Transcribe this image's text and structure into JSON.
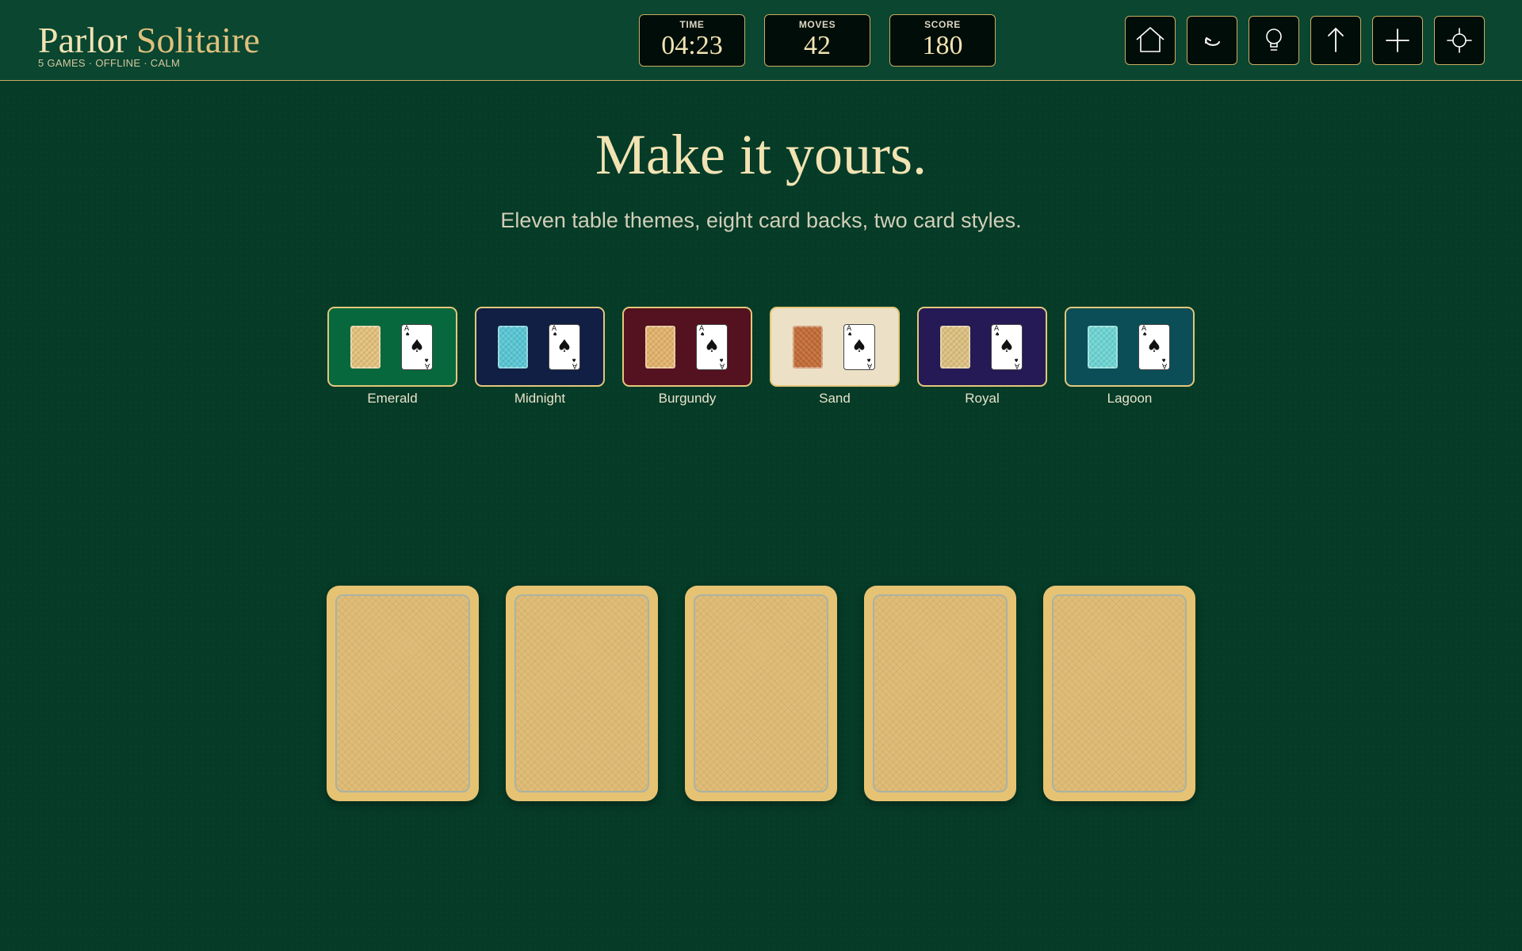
{
  "app": {
    "title_part1": "Parlor",
    "title_part2": "Solitaire",
    "subtitle": "5 GAMES · OFFLINE · CALM"
  },
  "stats": {
    "time": {
      "label": "TIME",
      "value": "04:23"
    },
    "moves": {
      "label": "MOVES",
      "value": "42"
    },
    "score": {
      "label": "SCORE",
      "value": "180"
    }
  },
  "toolbar": [
    {
      "name": "home-button",
      "icon": "home-icon"
    },
    {
      "name": "undo-button",
      "icon": "undo-icon"
    },
    {
      "name": "hint-button",
      "icon": "lightbulb-icon"
    },
    {
      "name": "auto-complete-button",
      "icon": "arrow-up-icon"
    },
    {
      "name": "new-game-button",
      "icon": "plus-icon"
    },
    {
      "name": "settings-button",
      "icon": "crosshair-icon"
    }
  ],
  "hero": {
    "headline": "Make it yours.",
    "subheadline": "Eleven table themes, eight card backs, two card styles."
  },
  "themes": [
    {
      "label": "Emerald",
      "table_color": "#07683e",
      "back_color": "#e2c07a"
    },
    {
      "label": "Midnight",
      "table_color": "#101f43",
      "back_color": "#56c6d3"
    },
    {
      "label": "Burgundy",
      "table_color": "#54111f",
      "back_color": "#e2b16a"
    },
    {
      "label": "Sand",
      "table_color": "#ece1c6",
      "back_color": "#c26a35"
    },
    {
      "label": "Royal",
      "table_color": "#251a55",
      "back_color": "#dcbf7e"
    },
    {
      "label": "Lagoon",
      "table_color": "#0b4e57",
      "back_color": "#6bd4d2"
    }
  ],
  "mini_ace": {
    "rank": "A",
    "suit": "♠"
  },
  "card_backs": {
    "count": 5,
    "color": "#e6c273"
  },
  "colors": {
    "accent_gold": "#c9ad62",
    "felt": "#053b27",
    "topbar": "#0a4630"
  }
}
